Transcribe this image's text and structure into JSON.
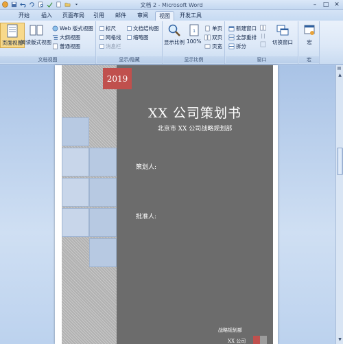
{
  "window": {
    "title": "文档 2 - Microsoft Word",
    "controls": [
      "–",
      "□",
      "✕"
    ]
  },
  "tabs": [
    {
      "label": "开始",
      "active": false
    },
    {
      "label": "插入",
      "active": false
    },
    {
      "label": "页面布局",
      "active": false
    },
    {
      "label": "引用",
      "active": false
    },
    {
      "label": "邮件",
      "active": false
    },
    {
      "label": "审阅",
      "active": false
    },
    {
      "label": "视图",
      "active": true
    },
    {
      "label": "开发工具",
      "active": false
    }
  ],
  "ribbon": {
    "doc_views": {
      "label": "文档视图",
      "print_layout": "页面视图",
      "read_layout": "阅读版式视图",
      "web_layout": "Web 版式视图",
      "outline": "大纲视图",
      "draft": "普通视图"
    },
    "show_hide": {
      "label": "显示/隐藏",
      "ruler": "标尺",
      "gridlines": "网格线",
      "message_bar": "消息栏",
      "doc_map": "文档结构图",
      "thumbnails": "缩略图"
    },
    "zoom": {
      "label": "显示比例",
      "zoom_btn": "显示比例",
      "hundred": "100%",
      "one_page": "单页",
      "two_pages": "双页",
      "page_width": "页宽"
    },
    "window": {
      "label": "窗口",
      "new_window": "新建窗口",
      "arrange_all": "全部重排",
      "split": "拆分",
      "switch_windows": "切换窗口"
    },
    "macros": {
      "label": "宏",
      "btn": "宏"
    }
  },
  "cover": {
    "year": "2019",
    "title": "XX 公司策划书",
    "subtitle": "北京市 XX 公司战略规划部",
    "planner_label": "策划人:",
    "approver_label": "批准人:",
    "footer_dept": "战略规划部",
    "footer_company": "XX 公司"
  },
  "colors": {
    "accent_red": "#c0504d",
    "panel_gray": "#6c6c6c",
    "tile_blue": "#b7c9e2"
  }
}
